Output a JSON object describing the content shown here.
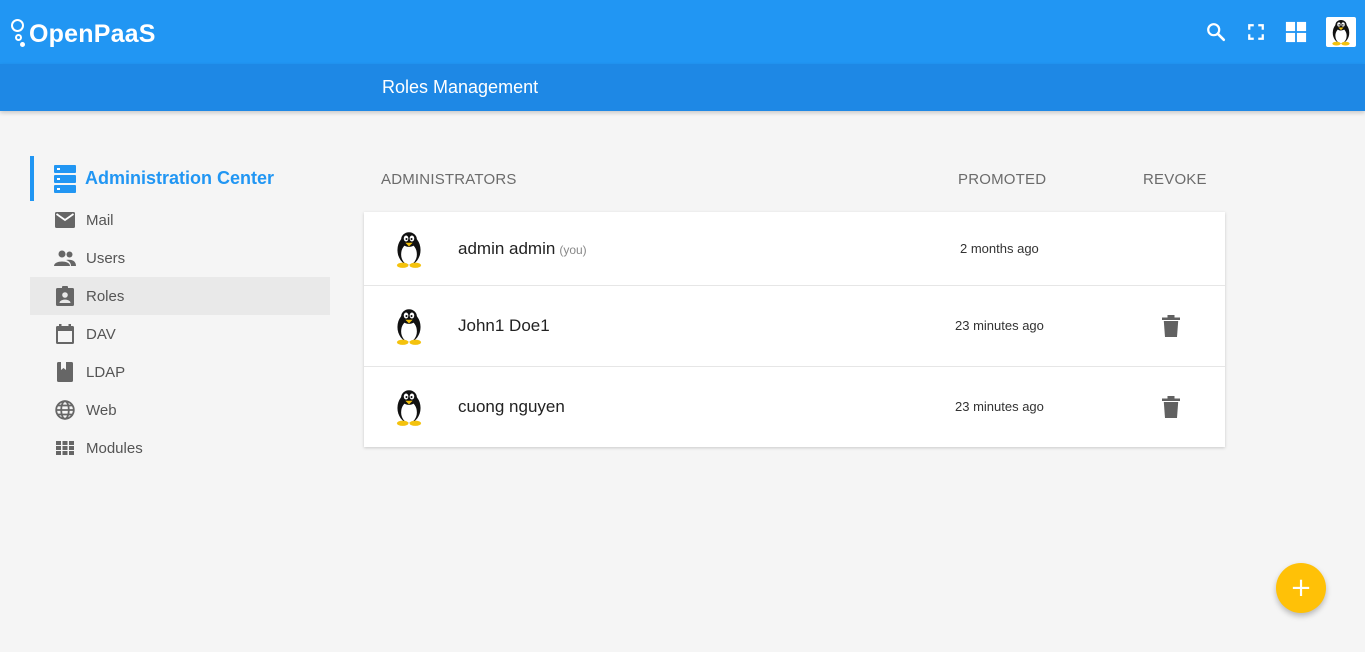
{
  "app": {
    "logo_text": "OpenPaaS"
  },
  "header": {
    "icons": [
      "search-icon",
      "fullscreen-icon",
      "apps-grid-icon"
    ],
    "subtitle": "Roles Management"
  },
  "sidebar": {
    "title": "Administration Center",
    "items": [
      {
        "label": "Mail",
        "icon": "mail-icon"
      },
      {
        "label": "Users",
        "icon": "users-icon"
      },
      {
        "label": "Roles",
        "icon": "roles-icon",
        "active": true
      },
      {
        "label": "DAV",
        "icon": "calendar-icon"
      },
      {
        "label": "LDAP",
        "icon": "book-icon"
      },
      {
        "label": "Web",
        "icon": "globe-icon"
      },
      {
        "label": "Modules",
        "icon": "modules-icon"
      }
    ]
  },
  "table": {
    "columns": {
      "administrators": "ADMINISTRATORS",
      "promoted": "PROMOTED",
      "revoke": "REVOKE"
    },
    "rows": [
      {
        "name": "admin admin",
        "you": "(you)",
        "promoted": "2 months ago",
        "revocable": false
      },
      {
        "name": "John1 Doe1",
        "you": "",
        "promoted": "23 minutes ago",
        "revocable": true
      },
      {
        "name": "cuong nguyen",
        "you": "",
        "promoted": "23 minutes ago",
        "revocable": true
      }
    ]
  },
  "fab": {
    "label": "+"
  },
  "colors": {
    "primary": "#2196f3",
    "primary_dark": "#1e88e5",
    "accent": "#ffc107"
  }
}
